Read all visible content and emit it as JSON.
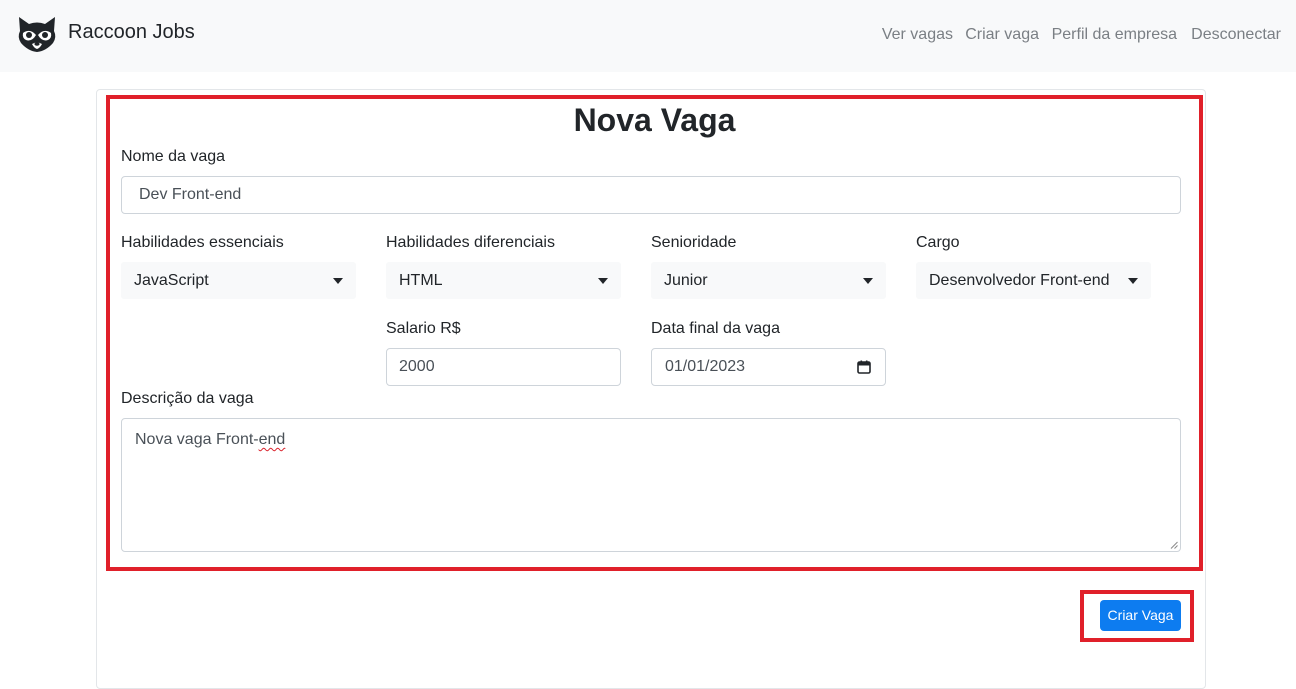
{
  "brand": {
    "name": "Raccoon Jobs",
    "logo": "raccoon-icon"
  },
  "nav": {
    "items": [
      {
        "label": "Ver vagas"
      },
      {
        "label": "Criar vaga"
      },
      {
        "label": "Perfil da empresa"
      },
      {
        "label": "Desconectar"
      }
    ]
  },
  "form": {
    "title": "Nova Vaga",
    "job_name": {
      "label": "Nome da vaga",
      "value": "Dev Front-end"
    },
    "essential_skills": {
      "label": "Habilidades essenciais",
      "selected": "JavaScript"
    },
    "differential_skills": {
      "label": "Habilidades diferenciais",
      "selected": "HTML"
    },
    "seniority": {
      "label": "Senioridade",
      "selected": "Junior"
    },
    "role": {
      "label": "Cargo",
      "selected": "Desenvolvedor Front-end"
    },
    "salary": {
      "label": "Salario R$",
      "value": "2000"
    },
    "end_date": {
      "label": "Data final da vaga",
      "value": "01/01/2023"
    },
    "description": {
      "label": "Descrição da vaga",
      "value_prefix": "Nova vaga Front-",
      "value_suffix": "end"
    },
    "submit_label": "Criar Vaga"
  },
  "colors": {
    "highlight": "#e0202a",
    "primary": "#0d7cf0",
    "navbar_bg": "#f8f9fa"
  }
}
